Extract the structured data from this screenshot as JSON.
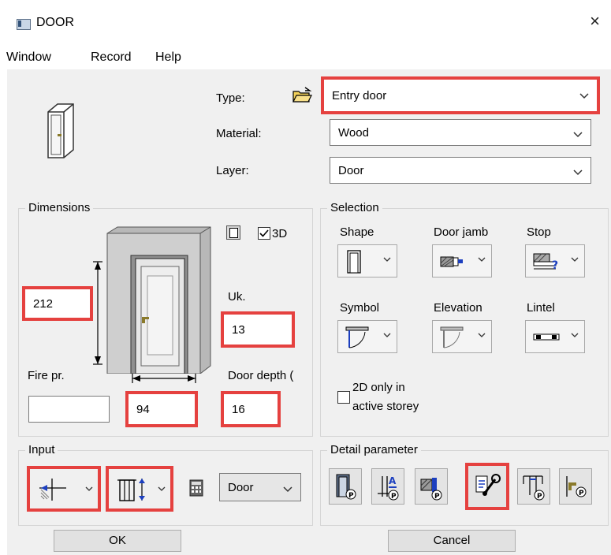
{
  "window": {
    "title": "DOOR",
    "close": "×"
  },
  "menu": [
    "Window",
    "Record",
    "Help"
  ],
  "top": {
    "type_label": "Type:",
    "type_value": "Entry door",
    "material_label": "Material:",
    "material_value": "Wood",
    "layer_label": "Layer:",
    "layer_value": "Door"
  },
  "dimensions": {
    "title": "Dimensions",
    "height": "212",
    "uk_label": "Uk.",
    "uk_value": "13",
    "fire_label": "Fire pr.",
    "fire_value": "",
    "width": "94",
    "depth_label": "Door depth (",
    "depth_value": "16",
    "threed_label": "3D",
    "threed_checked": true
  },
  "selection": {
    "title": "Selection",
    "shape": "Shape",
    "jamb": "Door jamb",
    "stop": "Stop",
    "symbol": "Symbol",
    "elevation": "Elevation",
    "lintel": "Lintel",
    "only2d_line1": "2D only in",
    "only2d_line2": "active storey"
  },
  "input": {
    "title": "Input",
    "mode_value": "Door"
  },
  "detail": {
    "title": "Detail parameter"
  },
  "buttons": {
    "ok": "OK",
    "cancel": "Cancel"
  },
  "colors": {
    "highlight": "#e5413f",
    "dialog_bg": "#f0f0f0"
  }
}
